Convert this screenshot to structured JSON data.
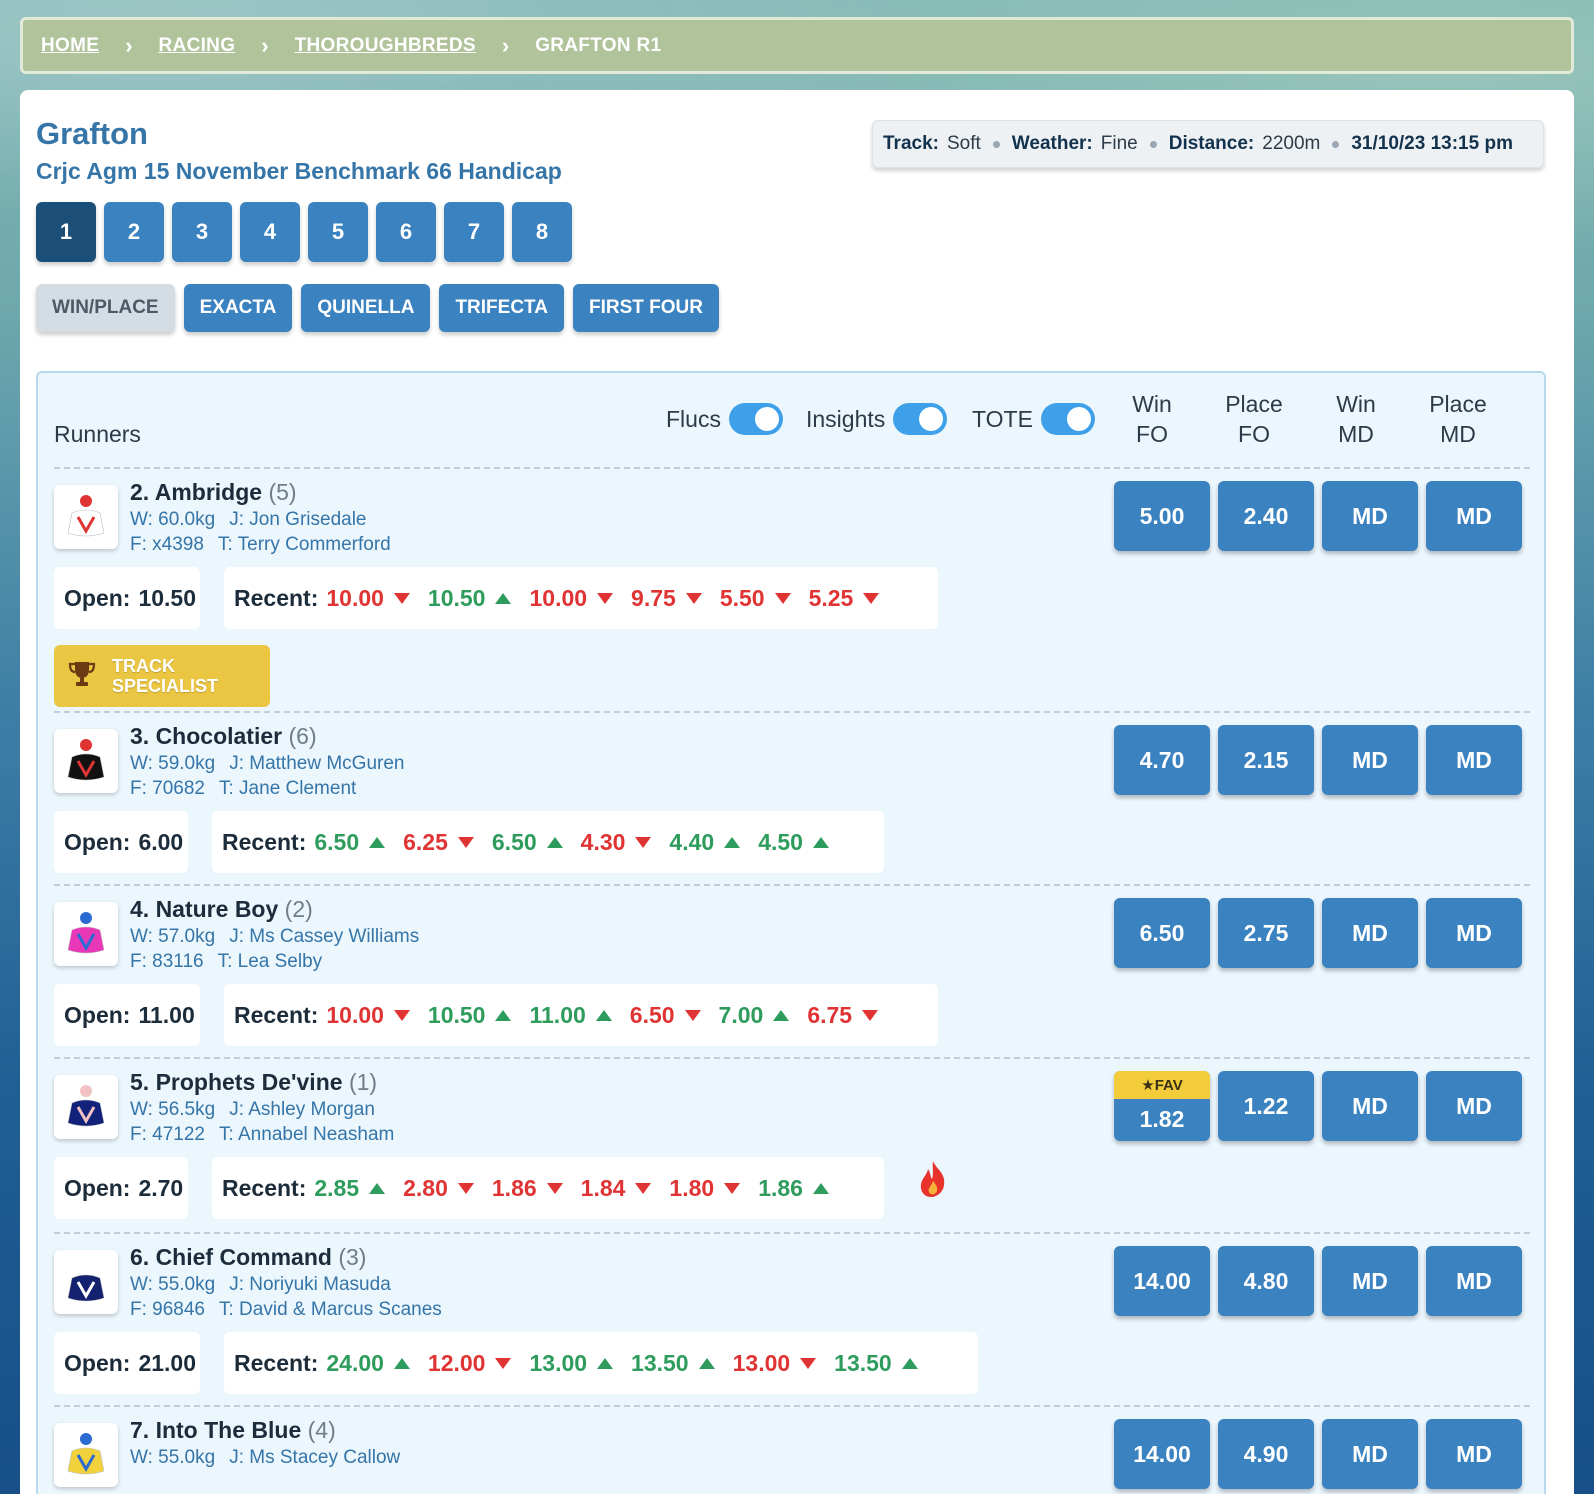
{
  "breadcrumb": [
    {
      "label": "HOME",
      "link": true
    },
    {
      "label": "RACING",
      "link": true
    },
    {
      "label": "THOROUGHBREDS",
      "link": true
    },
    {
      "label": "GRAFTON R1",
      "link": false
    }
  ],
  "race": {
    "venue": "Grafton",
    "name": "Crjc Agm 15 November Benchmark 66 Handicap",
    "track_label": "Track:",
    "track": "Soft",
    "weather_label": "Weather:",
    "weather": "Fine",
    "distance_label": "Distance:",
    "distance": "2200m",
    "datetime": "31/10/23 13:15 pm"
  },
  "race_numbers": [
    "1",
    "2",
    "3",
    "4",
    "5",
    "6",
    "7",
    "8"
  ],
  "active_race": "1",
  "bet_types": [
    "WIN/PLACE",
    "EXACTA",
    "QUINELLA",
    "TRIFECTA",
    "FIRST FOUR"
  ],
  "active_bet_type": "WIN/PLACE",
  "header": {
    "runners": "Runners",
    "flucs": "Flucs",
    "insights": "Insights",
    "tote": "TOTE",
    "col_win_fo": [
      "Win",
      "FO"
    ],
    "col_place_fo": [
      "Place",
      "FO"
    ],
    "col_win_md": [
      "Win",
      "MD"
    ],
    "col_place_md": [
      "Place",
      "MD"
    ]
  },
  "labels": {
    "open": "Open:",
    "recent": "Recent:",
    "fav": "FAV",
    "track_specialist": [
      "TRACK",
      "SPECIALIST"
    ]
  },
  "runners": [
    {
      "name": "2. Ambridge",
      "barrier": "(5)",
      "weight": "W: 60.0kg",
      "jockey": "J: Jon Grisedale",
      "form": "F: x4398",
      "trainer": "T: Terry Commerford",
      "win_fo": "5.00",
      "place_fo": "2.40",
      "win_md": "MD",
      "place_md": "MD",
      "open": "10.50",
      "recent": [
        {
          "v": "10.00",
          "d": "down"
        },
        {
          "v": "10.50",
          "d": "up"
        },
        {
          "v": "10.00",
          "d": "down"
        },
        {
          "v": "9.75",
          "d": "down"
        },
        {
          "v": "5.50",
          "d": "down"
        },
        {
          "v": "5.25",
          "d": "down"
        }
      ],
      "silk_colors": [
        "#ffffff",
        "#e03434"
      ],
      "track_specialist": true
    },
    {
      "name": "3. Chocolatier",
      "barrier": "(6)",
      "weight": "W: 59.0kg",
      "jockey": "J: Matthew McGuren",
      "form": "F: 70682",
      "trainer": "T: Jane Clement",
      "win_fo": "4.70",
      "place_fo": "2.15",
      "win_md": "MD",
      "place_md": "MD",
      "open": "6.00",
      "recent": [
        {
          "v": "6.50",
          "d": "up"
        },
        {
          "v": "6.25",
          "d": "down"
        },
        {
          "v": "6.50",
          "d": "up"
        },
        {
          "v": "4.30",
          "d": "down"
        },
        {
          "v": "4.40",
          "d": "up"
        },
        {
          "v": "4.50",
          "d": "up"
        }
      ],
      "silk_colors": [
        "#111111",
        "#e03434"
      ]
    },
    {
      "name": "4. Nature Boy",
      "barrier": "(2)",
      "weight": "W: 57.0kg",
      "jockey": "J: Ms Cassey Williams",
      "form": "F: 83116",
      "trainer": "T: Lea Selby",
      "win_fo": "6.50",
      "place_fo": "2.75",
      "win_md": "MD",
      "place_md": "MD",
      "open": "11.00",
      "recent": [
        {
          "v": "10.00",
          "d": "down"
        },
        {
          "v": "10.50",
          "d": "up"
        },
        {
          "v": "11.00",
          "d": "up"
        },
        {
          "v": "6.50",
          "d": "down"
        },
        {
          "v": "7.00",
          "d": "up"
        },
        {
          "v": "6.75",
          "d": "down"
        }
      ],
      "silk_colors": [
        "#e838b8",
        "#2b6bd1"
      ]
    },
    {
      "name": "5. Prophets De'vine",
      "barrier": "(1)",
      "weight": "W: 56.5kg",
      "jockey": "J: Ashley Morgan",
      "form": "F: 47122",
      "trainer": "T: Annabel Neasham",
      "win_fo": "1.82",
      "place_fo": "1.22",
      "win_md": "MD",
      "place_md": "MD",
      "open": "2.70",
      "fav": true,
      "hot": true,
      "recent": [
        {
          "v": "2.85",
          "d": "up"
        },
        {
          "v": "2.80",
          "d": "down"
        },
        {
          "v": "1.86",
          "d": "down"
        },
        {
          "v": "1.84",
          "d": "down"
        },
        {
          "v": "1.80",
          "d": "down"
        },
        {
          "v": "1.86",
          "d": "up"
        }
      ],
      "silk_colors": [
        "#12227a",
        "#f2c2c2"
      ]
    },
    {
      "name": "6. Chief Command",
      "barrier": "(3)",
      "weight": "W: 55.0kg",
      "jockey": "J: Noriyuki Masuda",
      "form": "F: 96846",
      "trainer": "T: David & Marcus Scanes",
      "win_fo": "14.00",
      "place_fo": "4.80",
      "win_md": "MD",
      "place_md": "MD",
      "open": "21.00",
      "recent": [
        {
          "v": "24.00",
          "d": "up"
        },
        {
          "v": "12.00",
          "d": "down"
        },
        {
          "v": "13.00",
          "d": "up"
        },
        {
          "v": "13.50",
          "d": "up"
        },
        {
          "v": "13.00",
          "d": "down"
        },
        {
          "v": "13.50",
          "d": "up"
        }
      ],
      "silk_colors": [
        "#14216e",
        "#ffffff"
      ]
    },
    {
      "name": "7. Into The Blue",
      "barrier": "(4)",
      "weight": "W: 55.0kg",
      "jockey": "J: Ms Stacey Callow",
      "form": "",
      "trainer": "",
      "win_fo": "14.00",
      "place_fo": "4.90",
      "win_md": "MD",
      "place_md": "MD",
      "silk_colors": [
        "#f2d23c",
        "#2b6bd1"
      ]
    }
  ]
}
